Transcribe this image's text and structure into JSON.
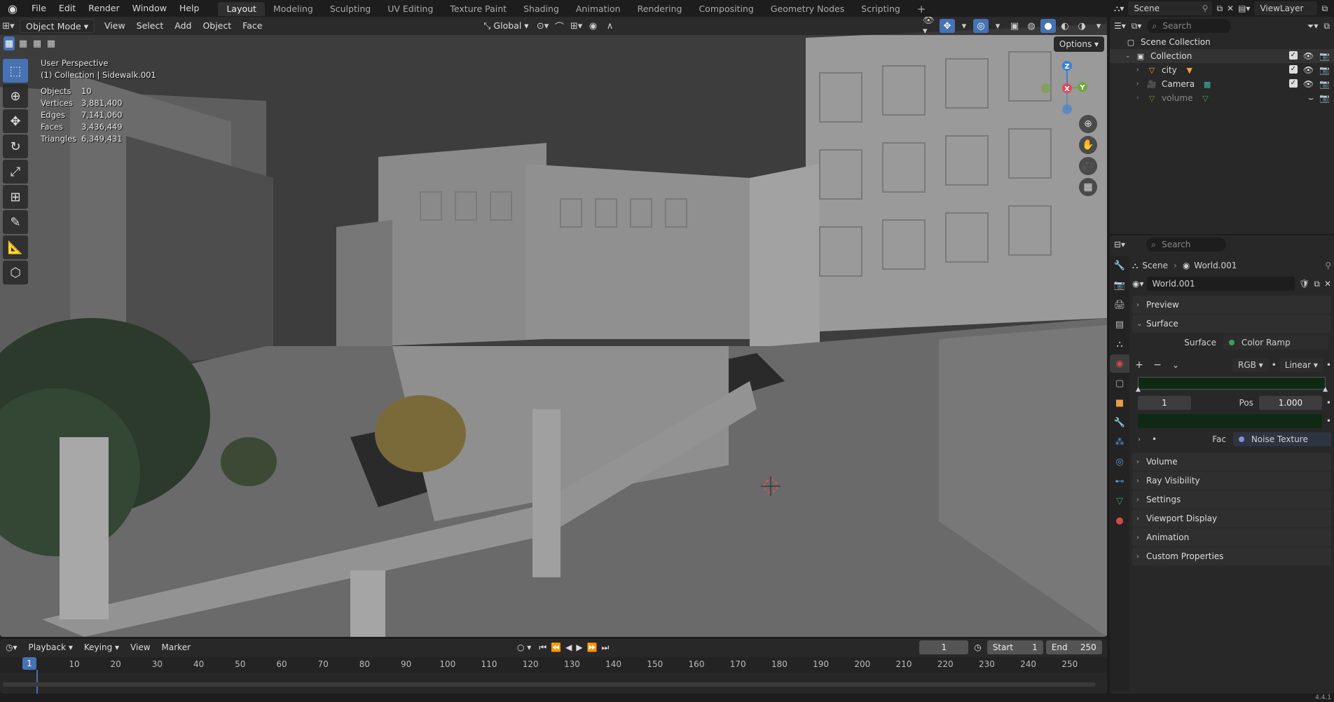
{
  "menubar": {
    "items": [
      "File",
      "Edit",
      "Render",
      "Window",
      "Help"
    ],
    "workspaces": [
      "Layout",
      "Modeling",
      "Sculpting",
      "UV Editing",
      "Texture Paint",
      "Shading",
      "Animation",
      "Rendering",
      "Compositing",
      "Geometry Nodes",
      "Scripting"
    ],
    "active_workspace": "Layout",
    "scene_label": "Scene",
    "viewlayer_label": "ViewLayer"
  },
  "viewport": {
    "mode": "Object Mode",
    "menus": [
      "View",
      "Select",
      "Add",
      "Object",
      "Face"
    ],
    "transform_orientation": "Global",
    "options_label": "Options",
    "view_name": "User Perspective",
    "active_info": "(1) Collection | Sidewalk.001",
    "stats": [
      {
        "key": "Objects",
        "value": "10"
      },
      {
        "key": "Vertices",
        "value": "3,881,400"
      },
      {
        "key": "Edges",
        "value": "7,141,060"
      },
      {
        "key": "Faces",
        "value": "3,436,449"
      },
      {
        "key": "Triangles",
        "value": "6,349,431"
      }
    ],
    "gizmo_axes": {
      "x": "X",
      "y": "Y",
      "z": "Z"
    },
    "colors": {
      "x": "#e3465a",
      "y": "#6fa63a",
      "z": "#3a7fd6"
    }
  },
  "timeline": {
    "menus": [
      "Playback",
      "Keying",
      "View",
      "Marker"
    ],
    "current_frame": "1",
    "start_label": "Start",
    "start_value": "1",
    "end_label": "End",
    "end_value": "250",
    "ruler": [
      "10",
      "20",
      "30",
      "40",
      "50",
      "60",
      "70",
      "80",
      "90",
      "100",
      "110",
      "120",
      "130",
      "140",
      "150",
      "160",
      "170",
      "180",
      "190",
      "200",
      "210",
      "220",
      "230",
      "240",
      "250"
    ],
    "cursor_label": "1"
  },
  "outliner": {
    "search_placeholder": "Search",
    "root": "Scene Collection",
    "collection": "Collection",
    "items": [
      {
        "name": "city",
        "icon": "mesh-icon"
      },
      {
        "name": "Camera",
        "icon": "camera-icon"
      },
      {
        "name": "volume",
        "icon": "mesh-icon"
      }
    ]
  },
  "properties": {
    "search_placeholder": "Search",
    "breadcrumb_scene": "Scene",
    "breadcrumb_world": "World.001",
    "world_name": "World.001",
    "panels_top": [
      "Preview",
      "Surface"
    ],
    "surface_label": "Surface",
    "surface_value": "Color Ramp",
    "ramp_mode": "RGB",
    "ramp_interp": "Linear",
    "ramp_index": "1",
    "pos_label": "Pos",
    "pos_value": "1.000",
    "fac_label": "Fac",
    "fac_value": "Noise Texture",
    "panels_bottom": [
      "Volume",
      "Ray Visibility",
      "Settings",
      "Viewport Display",
      "Animation",
      "Custom Properties"
    ]
  },
  "status": {
    "version": "4.4.1"
  }
}
